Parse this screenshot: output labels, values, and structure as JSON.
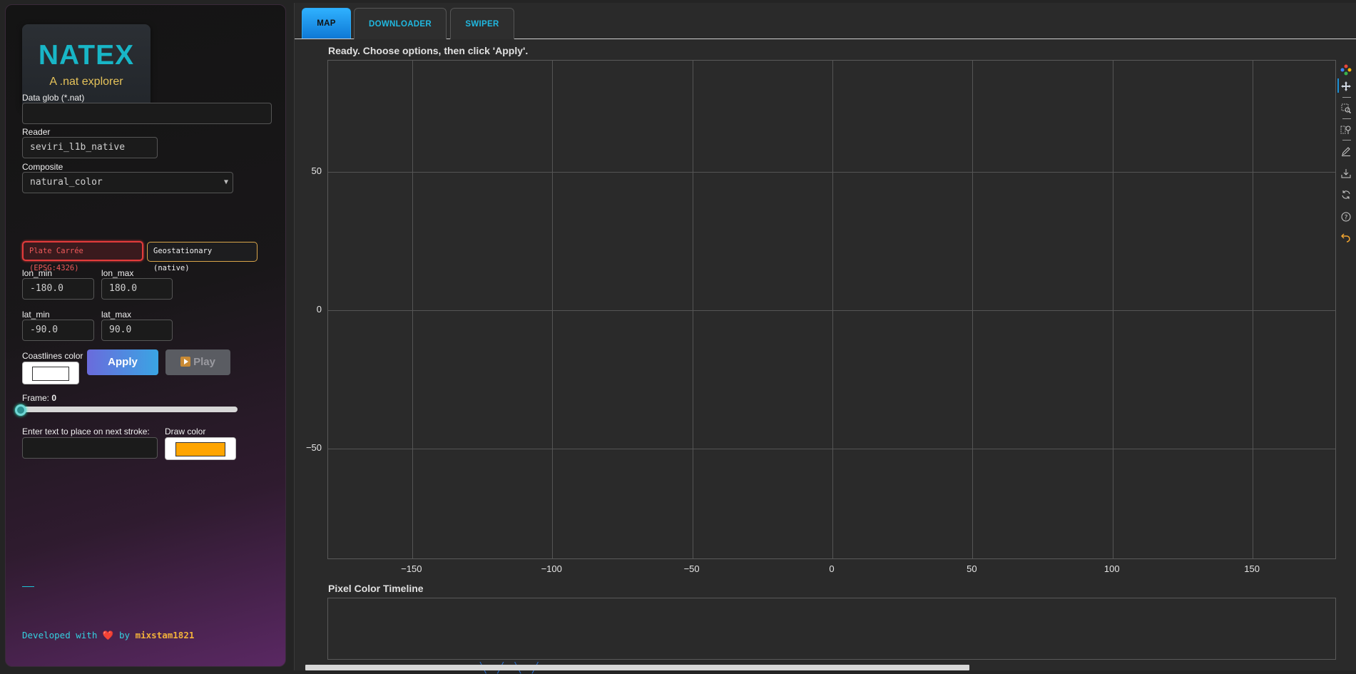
{
  "sidebar": {
    "logo": {
      "title": "NATEX",
      "subtitle": "A .nat explorer"
    },
    "data_glob": {
      "label": "Data glob (*.nat)",
      "value": "",
      "placeholder": ""
    },
    "reader": {
      "label": "Reader",
      "value": "seviri_l1b_native"
    },
    "composite": {
      "label": "Composite",
      "value": "natural_color"
    },
    "projections": [
      {
        "label": "Plate Carrée (EPSG:4326)",
        "selected": true
      },
      {
        "label": "Geostationary (native)",
        "selected": false
      }
    ],
    "lon_min": {
      "label": "lon_min",
      "value": "-180.0"
    },
    "lon_max": {
      "label": "lon_max",
      "value": "180.0"
    },
    "lat_min": {
      "label": "lat_min",
      "value": "-90.0"
    },
    "lat_max": {
      "label": "lat_max",
      "value": "90.0"
    },
    "coastlines": {
      "label": "Coastlines color",
      "color": "#ffffff"
    },
    "apply_label": "Apply",
    "play_label": "Play",
    "frame": {
      "label": "Frame: ",
      "value": "0"
    },
    "text_input": {
      "label": "Enter text to place on next stroke:",
      "value": ""
    },
    "draw_color": {
      "label": "Draw color",
      "color": "#ffa500"
    },
    "footer": {
      "prefix": "Developed with",
      "heart": "❤️",
      "by": "by",
      "author": "mixstam1821"
    }
  },
  "tabs": [
    {
      "label": "MAP",
      "active": true
    },
    {
      "label": "DOWNLOADER",
      "active": false
    },
    {
      "label": "SWIPER",
      "active": false
    }
  ],
  "status": "Ready. Choose options, then click 'Apply'.",
  "map": {
    "x_ticks": [
      "−150",
      "−100",
      "−50",
      "0",
      "50",
      "100",
      "150"
    ],
    "y_ticks": [
      "50",
      "0",
      "−50"
    ],
    "x_range": [
      -180,
      180
    ],
    "y_range": [
      -90,
      90
    ],
    "grid": true
  },
  "modebar": {
    "icons": [
      "plotly-logo-icon",
      "pan-icon",
      "box-zoom-icon",
      "box-select-icon",
      "freehand-draw-icon",
      "save-icon",
      "reset-icon",
      "hover-help-icon",
      "undo-icon"
    ]
  },
  "timeline": {
    "title": "Pixel Color Timeline"
  }
}
